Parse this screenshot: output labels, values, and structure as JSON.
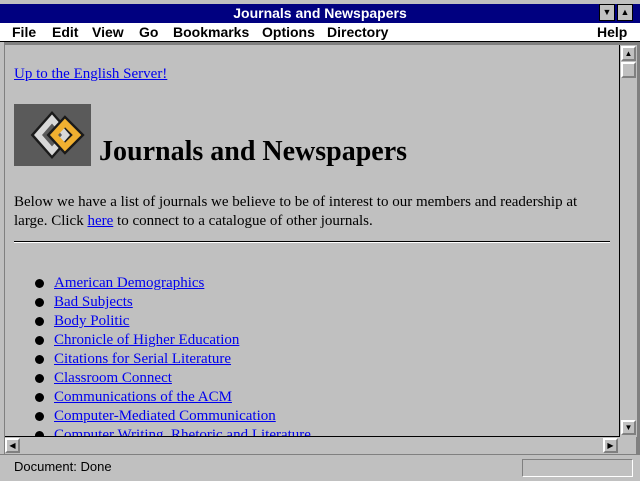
{
  "window": {
    "title": "Journals and Newspapers"
  },
  "menu": [
    {
      "label": "File"
    },
    {
      "label": "Edit"
    },
    {
      "label": "View"
    },
    {
      "label": "Go"
    },
    {
      "label": "Bookmarks"
    },
    {
      "label": "Options"
    },
    {
      "label": "Directory"
    },
    {
      "label": "Help"
    }
  ],
  "page": {
    "up_link": "Up to the English Server!",
    "heading": "Journals and Newspapers",
    "intro_before": "Below we have a list of journals we believe to be of interest to our members and readership at large. Click ",
    "intro_link": "here",
    "intro_after": " to connect to a catalogue of other journals.",
    "journals": [
      "American Demographics",
      "Bad Subjects",
      "Body Politic",
      "Chronicle of Higher Education",
      "Citations for Serial Literature",
      "Classroom Connect",
      "Communications of the ACM",
      "Computer-Mediated Communication",
      "Computer Writing, Rhetoric and Literature"
    ]
  },
  "status": {
    "text": "Document: Done"
  },
  "icons": {
    "logo": "interlocking-diamonds-logo",
    "minimize": "down-triangle-icon",
    "maximize": "up-triangle-icon"
  },
  "colors": {
    "titlebar": "#000080",
    "link": "#0000ee",
    "background": "#c0c0c0",
    "logo_gold": "#f0b030"
  }
}
